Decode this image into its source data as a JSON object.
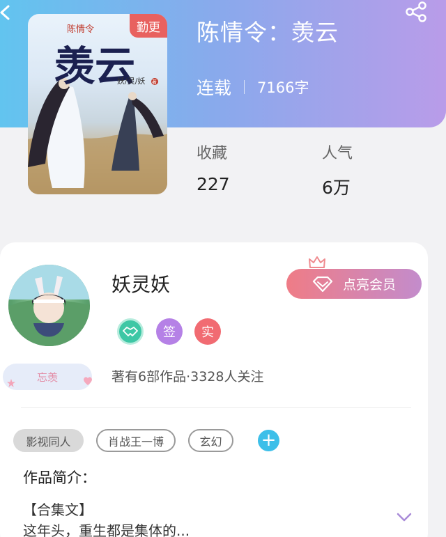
{
  "book": {
    "title": "陈情令：羡云",
    "status": "连载",
    "word_count": "7166字",
    "update_badge": "勤更",
    "cover_title": "羡云",
    "cover_series": "陈情令",
    "cover_author": "妖/灵/妖",
    "cover_author_seal": "著"
  },
  "stats": {
    "favorites_label": "收藏",
    "favorites_value": "227",
    "popularity_label": "人气",
    "popularity_value": "6万"
  },
  "author": {
    "name": "妖灵妖",
    "member_button": "点亮会员",
    "badges": [
      "签",
      "实"
    ],
    "fan_tag": "忘羡",
    "stats_text": "著有6部作品·3328人关注"
  },
  "tags": [
    "影视同人",
    "肖战王一博",
    "玄幻"
  ],
  "add_tag": "+",
  "intro": {
    "heading": "作品简介：",
    "line1": "【合集文】",
    "line2": "这年头，重生都是集体的..."
  },
  "colors": {
    "header_gradient": [
      "#62c4ef",
      "#b99ce9"
    ],
    "update_badge": "#e8615f",
    "badge_friend": "#3ec7a5",
    "badge_sign": "#b581e6",
    "badge_real": "#f16b72",
    "add_tag": "#3dbfe9"
  },
  "icons": [
    "back-icon",
    "share-icon",
    "crown-icon",
    "diamond-icon",
    "handshake-icon",
    "heart-icon",
    "chevron-down-icon"
  ]
}
